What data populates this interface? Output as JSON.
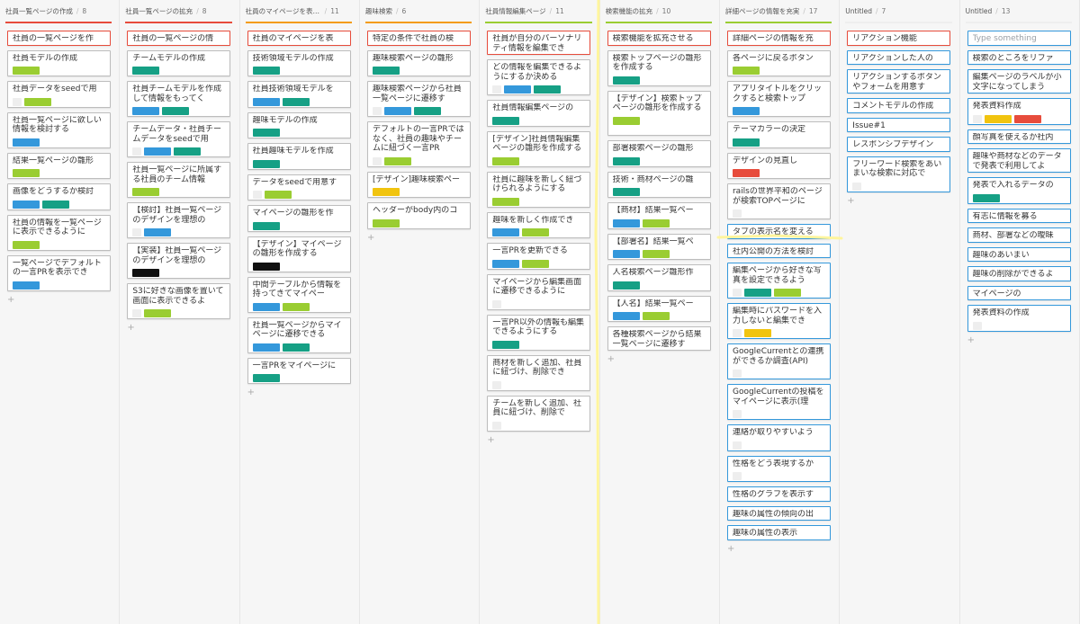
{
  "colors": {
    "red": "#e74c3c",
    "orange": "#f39c12",
    "green": "#9acd32",
    "blue": "#3498db",
    "teal": "#16a085",
    "black": "#111111",
    "yellow": "#f1c40f",
    "crimson": "#e74c3c",
    "gray": "#eeeeee",
    "highlight": "#fff59d"
  },
  "columns": [
    {
      "title": "社員一覧ページの作成",
      "count": "8",
      "underline": "#e74c3c",
      "cards": [
        {
          "text": "社員の一覧ページを作",
          "border": "#e74c3c",
          "lines": 1,
          "labels": []
        },
        {
          "text": "社員モデルの作成",
          "border": "#bdbdbd",
          "lines": 1,
          "labels": [
            "green"
          ]
        },
        {
          "text": "社員データをseedで用",
          "border": "#bdbdbd",
          "lines": 1,
          "labels": [
            "gray",
            "green"
          ]
        },
        {
          "text": "社員一覧ページに欲しい情報を検討する",
          "border": "#bdbdbd",
          "lines": 2,
          "labels": [
            "blue"
          ]
        },
        {
          "text": "結果一覧ページの雛形",
          "border": "#bdbdbd",
          "lines": 1,
          "labels": [
            "green"
          ]
        },
        {
          "text": "画像をどうするか検討",
          "border": "#bdbdbd",
          "lines": 1,
          "labels": [
            "blue",
            "teal"
          ]
        },
        {
          "text": "社員の情報を一覧ページに表示できるように",
          "border": "#bdbdbd",
          "lines": 2,
          "labels": [
            "green"
          ]
        },
        {
          "text": "一覧ページでデフォルトの一言PRを表示でき",
          "border": "#bdbdbd",
          "lines": 2,
          "labels": [
            "blue"
          ]
        }
      ]
    },
    {
      "title": "社員一覧ページの拡充",
      "count": "8",
      "underline": "#e74c3c",
      "cards": [
        {
          "text": "社員の一覧ページの情",
          "border": "#e74c3c",
          "lines": 1,
          "labels": []
        },
        {
          "text": "チームモデルの作成",
          "border": "#bdbdbd",
          "lines": 1,
          "labels": [
            "teal"
          ]
        },
        {
          "text": "社員チームモデルを作成して情報をもってく",
          "border": "#bdbdbd",
          "lines": 2,
          "labels": [
            "blue",
            "teal"
          ]
        },
        {
          "text": "チームデータ・社員チームデータをseedで用",
          "border": "#bdbdbd",
          "lines": 2,
          "labels": [
            "gray",
            "blue",
            "teal"
          ]
        },
        {
          "text": "社員一覧ページに所属する社員のチーム情報",
          "border": "#bdbdbd",
          "lines": 2,
          "labels": [
            "green"
          ]
        },
        {
          "text": "【検討】社員一覧ページのデザインを理想の",
          "border": "#bdbdbd",
          "lines": 2,
          "labels": [
            "gray",
            "blue"
          ]
        },
        {
          "text": "【実装】社員一覧ページのデザインを理想の",
          "border": "#bdbdbd",
          "lines": 2,
          "labels": [
            "black"
          ]
        },
        {
          "text": "S3に好きな画像を置いて画面に表示できるよ",
          "border": "#bdbdbd",
          "lines": 2,
          "labels": [
            "gray",
            "green"
          ]
        }
      ]
    },
    {
      "title": "社員のマイページを表示…",
      "count": "11",
      "underline": "#f39c12",
      "cards": [
        {
          "text": "社員のマイページを表",
          "border": "#e74c3c",
          "lines": 1,
          "labels": []
        },
        {
          "text": "技術領域モデルの作成",
          "border": "#bdbdbd",
          "lines": 1,
          "labels": [
            "teal"
          ]
        },
        {
          "text": "社員技術領域モデルを",
          "border": "#bdbdbd",
          "lines": 1,
          "labels": [
            "blue",
            "teal"
          ]
        },
        {
          "text": "趣味モデルの作成",
          "border": "#bdbdbd",
          "lines": 1,
          "labels": [
            "teal"
          ]
        },
        {
          "text": "社員趣味モデルを作成",
          "border": "#bdbdbd",
          "lines": 1,
          "labels": [
            "teal"
          ]
        },
        {
          "text": "データをseedで用意す",
          "border": "#bdbdbd",
          "lines": 1,
          "labels": [
            "gray",
            "green"
          ]
        },
        {
          "text": "マイページの雛形を作",
          "border": "#bdbdbd",
          "lines": 1,
          "labels": [
            "teal"
          ]
        },
        {
          "text": "【デザイン】マイページの雛形を作成する",
          "border": "#bdbdbd",
          "lines": 2,
          "labels": [
            "black"
          ]
        },
        {
          "text": "中間テーブルから情報を持ってきてマイペー",
          "border": "#bdbdbd",
          "lines": 2,
          "labels": [
            "blue",
            "green"
          ]
        },
        {
          "text": "社員一覧ページからマイページに遷移できる",
          "border": "#bdbdbd",
          "lines": 2,
          "labels": [
            "blue",
            "teal"
          ]
        },
        {
          "text": "一言PRをマイページに",
          "border": "#bdbdbd",
          "lines": 1,
          "labels": [
            "teal"
          ]
        }
      ]
    },
    {
      "title": "趣味検索",
      "count": "6",
      "underline": "#f39c12",
      "cards": [
        {
          "text": "特定の条件で社員の検",
          "border": "#e74c3c",
          "lines": 1,
          "labels": []
        },
        {
          "text": "趣味検索ページの雛形",
          "border": "#bdbdbd",
          "lines": 1,
          "labels": [
            "teal"
          ]
        },
        {
          "text": "趣味検索ページから社員一覧ページに遷移す",
          "border": "#bdbdbd",
          "lines": 2,
          "labels": [
            "gray",
            "blue",
            "teal"
          ]
        },
        {
          "text": "デフォルトの一言PRではなく、社員の趣味やチームに紐づく一言PR",
          "border": "#bdbdbd",
          "lines": 3,
          "labels": [
            "gray",
            "green"
          ]
        },
        {
          "text": "[デザイン]趣味検索ペー",
          "border": "#bdbdbd",
          "lines": 1,
          "labels": [
            "yellow"
          ]
        },
        {
          "text": "ヘッダーがbody内のコ",
          "border": "#bdbdbd",
          "lines": 1,
          "labels": [
            "green"
          ]
        }
      ]
    },
    {
      "title": "社員情報編集ページ",
      "count": "11",
      "underline": "#9acd32",
      "cards": [
        {
          "text": "社員が自分のパーソナリティ情報を編集でき",
          "border": "#e74c3c",
          "lines": 2,
          "labels": []
        },
        {
          "text": "どの情報を編集できるようにするか決める",
          "border": "#bdbdbd",
          "lines": 2,
          "labels": [
            "gray",
            "blue",
            "teal"
          ]
        },
        {
          "text": "社員情報編集ページの",
          "border": "#bdbdbd",
          "lines": 1,
          "labels": [
            "teal"
          ]
        },
        {
          "text": "[デザイン]社員情報編集ページの雛形を作成する",
          "border": "#bdbdbd",
          "lines": 2,
          "labels": [
            "green"
          ]
        },
        {
          "text": "社員に趣味を新しく紐づけられるようにする",
          "border": "#bdbdbd",
          "lines": 2,
          "labels": [
            "green"
          ]
        },
        {
          "text": "趣味を新しく作成でき",
          "border": "#bdbdbd",
          "lines": 1,
          "labels": [
            "blue",
            "green"
          ]
        },
        {
          "text": "一言PRを更新できる",
          "border": "#bdbdbd",
          "lines": 1,
          "labels": [
            "blue",
            "green"
          ]
        },
        {
          "text": "マイページから編集画面に遷移できるように",
          "border": "#bdbdbd",
          "lines": 2,
          "labels": [
            "gray"
          ]
        },
        {
          "text": "一言PR以外の情報も編集できるようにする",
          "border": "#bdbdbd",
          "lines": 2,
          "labels": [
            "teal"
          ]
        },
        {
          "text": "商材を新しく追加、社員に紐づけ、削除でき",
          "border": "#bdbdbd",
          "lines": 2,
          "labels": [
            "gray"
          ]
        },
        {
          "text": "チームを新しく追加、社員に紐づけ、削除で",
          "border": "#bdbdbd",
          "lines": 2,
          "labels": [
            "gray"
          ]
        }
      ]
    },
    {
      "title": "検索機能の拡充",
      "count": "10",
      "underline": "#9acd32",
      "cards": [
        {
          "text": "検索機能を拡充させる",
          "border": "#e74c3c",
          "lines": 1,
          "labels": []
        },
        {
          "text": "検索トップページの雛形を作成する",
          "border": "#bdbdbd",
          "lines": 2,
          "labels": [
            "teal"
          ]
        },
        {
          "text": "【デザイン】検索トップページの雛形を作成する",
          "border": "#bdbdbd",
          "lines": 3,
          "labels": [
            "green"
          ]
        },
        {
          "text": "部署検索ページの雛形",
          "border": "#bdbdbd",
          "lines": 1,
          "labels": [
            "teal"
          ]
        },
        {
          "text": "技術・商材ページの雛",
          "border": "#bdbdbd",
          "lines": 1,
          "labels": [
            "teal"
          ]
        },
        {
          "text": "【商材】結果一覧ペー",
          "border": "#bdbdbd",
          "lines": 1,
          "labels": [
            "blue",
            "green"
          ]
        },
        {
          "text": "【部署名】結果一覧ペ",
          "border": "#bdbdbd",
          "lines": 1,
          "labels": [
            "blue",
            "green"
          ]
        },
        {
          "text": "人名検索ページ雛形作",
          "border": "#bdbdbd",
          "lines": 1,
          "labels": [
            "teal"
          ]
        },
        {
          "text": "【人名】結果一覧ペー",
          "border": "#bdbdbd",
          "lines": 1,
          "labels": [
            "blue",
            "green"
          ]
        },
        {
          "text": "各種検索ページから結果一覧ページに遷移す",
          "border": "#bdbdbd",
          "lines": 2,
          "labels": []
        }
      ]
    },
    {
      "title": "詳細ページの情報を充実",
      "count": "17",
      "underline": "#9acd32",
      "cards": [
        {
          "text": "詳細ページの情報を充",
          "border": "#e74c3c",
          "lines": 1,
          "labels": []
        },
        {
          "text": "各ページに戻るボタン",
          "border": "#bdbdbd",
          "lines": 1,
          "labels": [
            "green"
          ]
        },
        {
          "text": "アプリタイトルをクリックすると検索トップ",
          "border": "#bdbdbd",
          "lines": 2,
          "labels": [
            "blue"
          ]
        },
        {
          "text": "テーマカラーの決定",
          "border": "#bdbdbd",
          "lines": 1,
          "labels": [
            "teal"
          ]
        },
        {
          "text": "デザインの見直し",
          "border": "#bdbdbd",
          "lines": 1,
          "labels": [
            "crimson"
          ]
        },
        {
          "text": "railsの世界平和のページが検索TOPページに",
          "border": "#bdbdbd",
          "lines": 2,
          "labels": [
            "gray"
          ]
        },
        {
          "text": "タブの表示名を変える",
          "border": "#3498db",
          "lines": 1,
          "labels": []
        },
        {
          "text": "社内公開の方法を検討",
          "border": "#3498db",
          "lines": 1,
          "labels": []
        },
        {
          "text": "編集ページから好きな写真を設定できるよう",
          "border": "#3498db",
          "lines": 2,
          "labels": [
            "gray",
            "teal",
            "green"
          ]
        },
        {
          "text": "編集時にパスワードを入力しないと編集でき",
          "border": "#3498db",
          "lines": 2,
          "labels": [
            "gray",
            "yellow"
          ]
        },
        {
          "text": "GoogleCurrentとの連携ができるか調査(API)",
          "border": "#3498db",
          "lines": 2,
          "labels": [
            "gray"
          ]
        },
        {
          "text": "GoogleCurrentの投稿をマイページに表示(理",
          "border": "#3498db",
          "lines": 2,
          "labels": [
            "gray"
          ]
        },
        {
          "text": "連絡が取りやすいよう",
          "border": "#3498db",
          "lines": 1,
          "labels": [
            "gray"
          ]
        },
        {
          "text": "性格をどう表現するか",
          "border": "#3498db",
          "lines": 1,
          "labels": [
            "gray"
          ]
        },
        {
          "text": "性格のグラフを表示す",
          "border": "#3498db",
          "lines": 1,
          "labels": []
        },
        {
          "text": "趣味の属性の傾向の出",
          "border": "#3498db",
          "lines": 1,
          "labels": []
        },
        {
          "text": "趣味の属性の表示",
          "border": "#3498db",
          "lines": 1,
          "labels": []
        }
      ]
    },
    {
      "title": "Untitled",
      "count": "7",
      "underline": "#eeeeee",
      "cards": [
        {
          "text": "リアクション機能",
          "border": "#e74c3c",
          "lines": 1,
          "labels": []
        },
        {
          "text": "リアクションした人の",
          "border": "#3498db",
          "lines": 1,
          "labels": []
        },
        {
          "text": "リアクションするボタンやフォームを用意す",
          "border": "#3498db",
          "lines": 2,
          "labels": []
        },
        {
          "text": "コメントモデルの作成",
          "border": "#3498db",
          "lines": 1,
          "labels": []
        },
        {
          "text": "Issue#1",
          "border": "#3498db",
          "lines": 1,
          "labels": []
        },
        {
          "text": "レスポンシブデザイン",
          "border": "#3498db",
          "lines": 1,
          "labels": []
        },
        {
          "text": "フリーワード検索をあいまいな検索に対応で",
          "border": "#3498db",
          "lines": 2,
          "labels": [
            "gray"
          ]
        }
      ]
    },
    {
      "title": "Untitled",
      "count": "13",
      "underline": "#eeeeee",
      "cards": [
        {
          "text": "Type something",
          "border": "#3498db",
          "lines": 1,
          "labels": [],
          "placeholder": true
        },
        {
          "text": "検索のところをリファ",
          "border": "#3498db",
          "lines": 1,
          "labels": []
        },
        {
          "text": "編集ページのラベルが小文字になってしまう",
          "border": "#3498db",
          "lines": 2,
          "labels": []
        },
        {
          "text": "発表資料作成",
          "border": "#3498db",
          "lines": 1,
          "labels": [
            "gray",
            "yellow",
            "crimson"
          ]
        },
        {
          "text": "顔写真を使えるか社内",
          "border": "#3498db",
          "lines": 1,
          "labels": []
        },
        {
          "text": "趣味や商材などのデータで発表で利用してよ",
          "border": "#3498db",
          "lines": 2,
          "labels": []
        },
        {
          "text": "発表で入れるデータの",
          "border": "#3498db",
          "lines": 1,
          "labels": [
            "teal"
          ]
        },
        {
          "text": "有志に情報を募る",
          "border": "#3498db",
          "lines": 1,
          "labels": []
        },
        {
          "text": "商材、部署などの曖昧",
          "border": "#3498db",
          "lines": 1,
          "labels": []
        },
        {
          "text": "趣味のあいまい",
          "border": "#3498db",
          "lines": 1,
          "labels": []
        },
        {
          "text": "趣味の削除ができるよ",
          "border": "#3498db",
          "lines": 1,
          "labels": []
        },
        {
          "text": "マイページの",
          "border": "#3498db",
          "lines": 1,
          "labels": []
        },
        {
          "text": "発表資料の作成",
          "border": "#3498db",
          "lines": 1,
          "labels": [
            "gray"
          ]
        }
      ]
    }
  ],
  "add_glyph": "+"
}
